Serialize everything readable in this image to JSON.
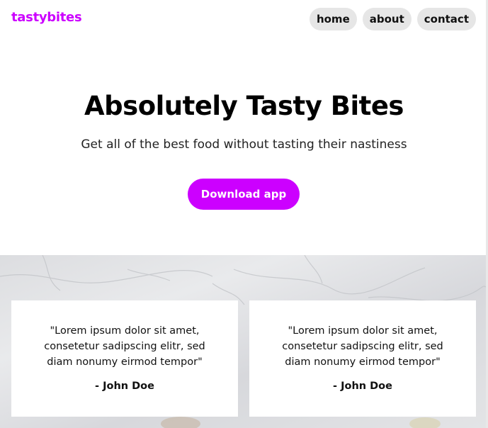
{
  "header": {
    "brand": "tastybites",
    "nav": [
      {
        "label": "home"
      },
      {
        "label": "about"
      },
      {
        "label": "contact"
      }
    ]
  },
  "hero": {
    "title": "Absolutely Tasty Bites",
    "subtitle": "Get all of the best food without tasting their nastiness",
    "cta_label": "Download app"
  },
  "testimonials": [
    {
      "quote": "\"Lorem ipsum dolor sit amet, consetetur sadipscing elitr, sed diam nonumy eirmod tempor\"",
      "author": "- John Doe"
    },
    {
      "quote": "\"Lorem ipsum dolor sit amet, consetetur sadipscing elitr, sed diam nonumy eirmod tempor\"",
      "author": "- John Doe"
    }
  ],
  "colors": {
    "accent": "#cc00ff",
    "nav_pill": "#e6e6e6",
    "band_background": "#dfe0e3"
  }
}
